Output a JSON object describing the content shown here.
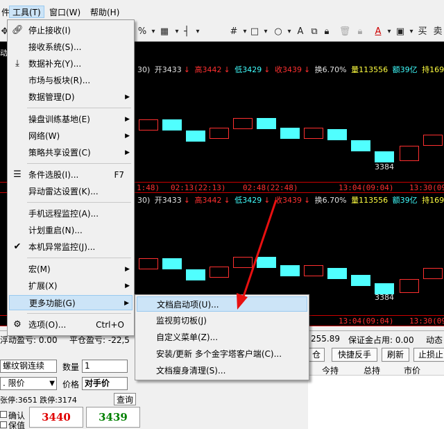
{
  "menubar": {
    "items": [
      {
        "label": "件(F)"
      },
      {
        "label": "工具(T)"
      },
      {
        "label": "窗口(W)"
      },
      {
        "label": "帮助(H)"
      }
    ]
  },
  "toolbar": {
    "icons": [
      "percent-icon",
      "bar-chart-icon",
      "divider",
      "hash-icon",
      "square-icon",
      "circle-icon",
      "letter-a-icon",
      "copy-icon",
      "lock-icon",
      "trash-icon",
      "lock-icon",
      "font-color-icon",
      "save-icon",
      "buy-label",
      "sell-label"
    ],
    "buy_label": "买",
    "sell_label": "卖"
  },
  "chart": {
    "top_info": {
      "prefix": "30)",
      "open_label": "开3433",
      "high_label": "高3442",
      "low_label": "低3429",
      "close_label": "收3439",
      "turnover": "换6.70%",
      "volume": "量113556",
      "amount": "额39亿",
      "hold": "持169"
    },
    "bottom_info": {
      "prefix": "30)",
      "open_label": "开3433",
      "high_label": "高3442",
      "low_label": "低3429",
      "close_label": "收3439",
      "turnover": "换6.70%",
      "volume": "量113556",
      "amount": "额39亿",
      "hold": "持169"
    },
    "time_labels": [
      "1:48)",
      "02:13(22:13)",
      "02:48(22:48)",
      "13:04(09:04)",
      "13:30(09"
    ],
    "low_mark": "3384",
    "left_label_top": "动"
  },
  "tools_menu": {
    "items": [
      {
        "label": "停止接收(I)",
        "icon": "link-icon"
      },
      {
        "label": "接收系统(S)..."
      },
      {
        "label": "数据补充(Y)...",
        "icon": "download-icon"
      },
      {
        "label": "市场与板块(R)..."
      },
      {
        "label": "数据管理(D)",
        "submenu": true
      },
      {
        "label": "操盘训练基地(E)",
        "submenu": true
      },
      {
        "label": "网络(W)",
        "submenu": true
      },
      {
        "label": "策略共享设置(C)",
        "submenu": true
      },
      {
        "label": "条件选股(I)...",
        "shortcut": "F7",
        "icon": "filter-icon"
      },
      {
        "label": "异动雷达设置(K)..."
      },
      {
        "label": "手机远程监控(A)..."
      },
      {
        "label": "计划重启(N)..."
      },
      {
        "label": "本机异常监控(J)...",
        "icon": "check-icon"
      },
      {
        "label": "宏(M)",
        "submenu": true
      },
      {
        "label": "扩展(X)",
        "submenu": true
      },
      {
        "label": "更多功能(G)",
        "submenu": true
      },
      {
        "label": "选项(O)...",
        "shortcut": "Ctrl+O",
        "icon": "gear-icon"
      }
    ]
  },
  "more_menu": {
    "items": [
      {
        "label": "文档启动项(U)..."
      },
      {
        "label": "监视剪切板(J)"
      },
      {
        "label": "自定义菜单(Z)..."
      },
      {
        "label": "安装/更新 多个金字塔客户端(C)..."
      },
      {
        "label": "文档瘦身清理(S)..."
      }
    ]
  },
  "trading": {
    "float_pnl": "浮动盈亏: 0.00",
    "close_pnl": "平仓盈亏: -22,5",
    "equity_tail": "255.89",
    "margin": "保证金占用: 0.00",
    "dynamic": "动态",
    "contract": "螺纹钢连续",
    "qty_label": "数量",
    "qty_value": "1",
    "order_type": ". 限价",
    "price_label": "价格",
    "price_value": "对手价",
    "limit_info": "张停:3651  跌停:3174",
    "query_btn": "查询",
    "confirm_label": "确认",
    "keep_label": "保值",
    "sell_price": "3440",
    "buy_price": "3439",
    "btn_cang": "仓",
    "btn_quick": "快捷反手",
    "btn_refresh": "刷新",
    "btn_stop": "止损止",
    "col_today": "今持",
    "col_total": "总持",
    "col_price": "市价"
  }
}
